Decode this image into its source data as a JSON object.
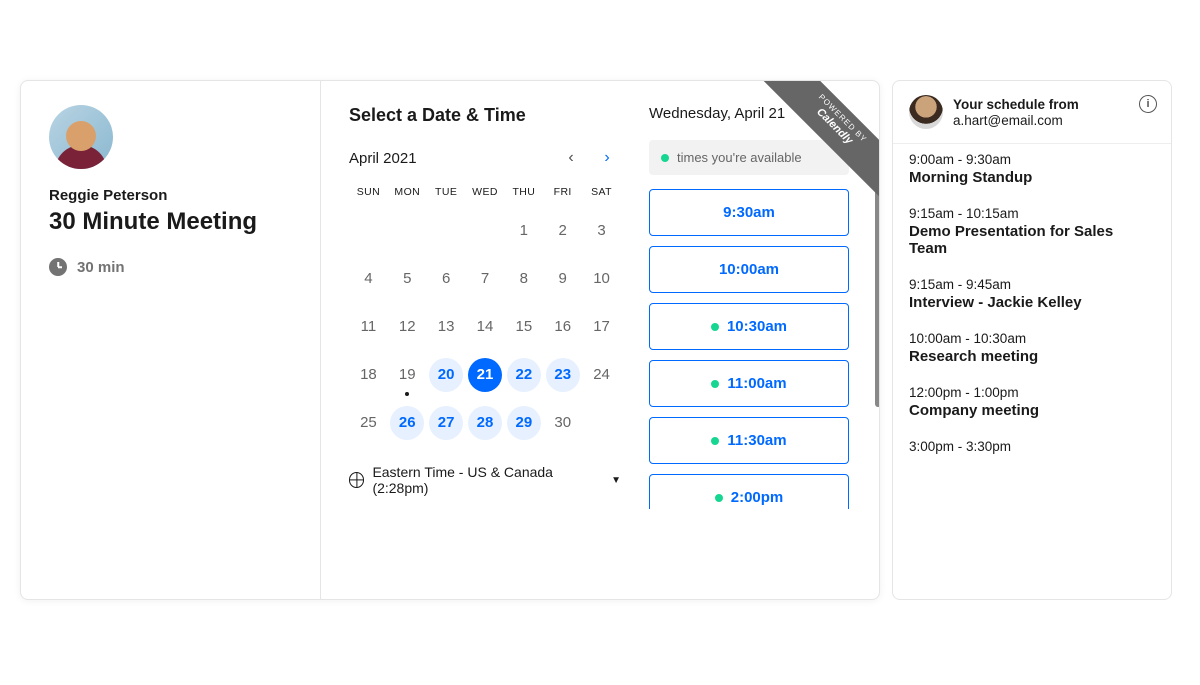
{
  "host": {
    "name": "Reggie Peterson",
    "meeting_title": "30 Minute Meeting",
    "duration_label": "30 min"
  },
  "picker": {
    "title": "Select a Date & Time",
    "month_label": "April 2021",
    "dow": [
      "SUN",
      "MON",
      "TUE",
      "WED",
      "THU",
      "FRI",
      "SAT"
    ],
    "days": [
      {
        "n": "",
        "state": "blank"
      },
      {
        "n": "",
        "state": "blank"
      },
      {
        "n": "",
        "state": "blank"
      },
      {
        "n": "",
        "state": "blank"
      },
      {
        "n": "1",
        "state": "past"
      },
      {
        "n": "2",
        "state": "past"
      },
      {
        "n": "3",
        "state": "past"
      },
      {
        "n": "4",
        "state": "past"
      },
      {
        "n": "5",
        "state": "past"
      },
      {
        "n": "6",
        "state": "past"
      },
      {
        "n": "7",
        "state": "past"
      },
      {
        "n": "8",
        "state": "past"
      },
      {
        "n": "9",
        "state": "past"
      },
      {
        "n": "10",
        "state": "past"
      },
      {
        "n": "11",
        "state": "past"
      },
      {
        "n": "12",
        "state": "past"
      },
      {
        "n": "13",
        "state": "past"
      },
      {
        "n": "14",
        "state": "past"
      },
      {
        "n": "15",
        "state": "past"
      },
      {
        "n": "16",
        "state": "past"
      },
      {
        "n": "17",
        "state": "past"
      },
      {
        "n": "18",
        "state": "past"
      },
      {
        "n": "19",
        "state": "today"
      },
      {
        "n": "20",
        "state": "available"
      },
      {
        "n": "21",
        "state": "selected"
      },
      {
        "n": "22",
        "state": "available"
      },
      {
        "n": "23",
        "state": "available"
      },
      {
        "n": "24",
        "state": "past"
      },
      {
        "n": "25",
        "state": "past"
      },
      {
        "n": "26",
        "state": "available"
      },
      {
        "n": "27",
        "state": "available"
      },
      {
        "n": "28",
        "state": "available"
      },
      {
        "n": "29",
        "state": "available"
      },
      {
        "n": "30",
        "state": "past"
      }
    ],
    "timezone": "Eastern Time - US & Canada (2:28pm)"
  },
  "slots": {
    "date_label": "Wednesday, April 21",
    "legend": "times you're available",
    "items": [
      {
        "time": "9:30am",
        "own": false
      },
      {
        "time": "10:00am",
        "own": false
      },
      {
        "time": "10:30am",
        "own": true
      },
      {
        "time": "11:00am",
        "own": true
      },
      {
        "time": "11:30am",
        "own": true
      },
      {
        "time": "2:00pm",
        "own": true
      }
    ]
  },
  "ribbon": {
    "line1": "POWERED BY",
    "line2": "Calendly"
  },
  "schedule": {
    "title": "Your schedule from",
    "email": "a.hart@email.com",
    "events": [
      {
        "time": "9:00am - 9:30am",
        "name": "Morning Standup"
      },
      {
        "time": "9:15am - 10:15am",
        "name": "Demo Presentation for Sales Team"
      },
      {
        "time": "9:15am - 9:45am",
        "name": "Interview - Jackie Kelley"
      },
      {
        "time": "10:00am - 10:30am",
        "name": "Research meeting"
      },
      {
        "time": "12:00pm - 1:00pm",
        "name": "Company meeting"
      },
      {
        "time": "3:00pm - 3:30pm",
        "name": ""
      }
    ]
  }
}
